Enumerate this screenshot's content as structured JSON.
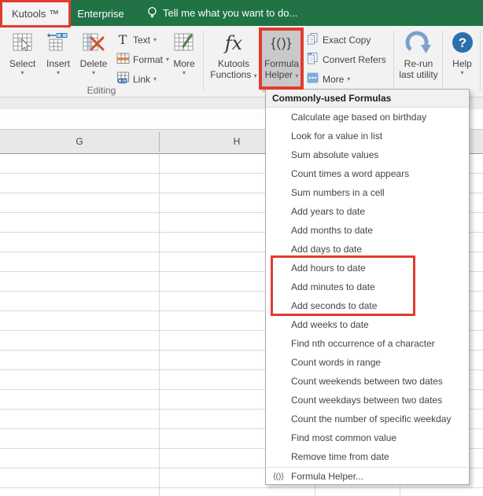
{
  "colors": {
    "excel_green": "#217346",
    "annotation_red": "#e23b2e",
    "help_blue": "#2c6fad",
    "pressed_gray": "#c9c9c9"
  },
  "tab_bar": {
    "tabs": [
      {
        "label": "Kutools ™"
      },
      {
        "label": "Enterprise"
      }
    ],
    "tell_me": "Tell me what you want to do..."
  },
  "ribbon": {
    "group_label": "Editing",
    "select_label": "Select",
    "insert_label": "Insert",
    "delete_label": "Delete",
    "text_label": "Text",
    "format_label": "Format",
    "link_label": "Link",
    "more_label": "More",
    "kutools_functions": {
      "icon": "fx",
      "line1": "Kutools",
      "line2": "Functions"
    },
    "formula_helper": {
      "icon": "{()}",
      "line1": "Formula",
      "line2": "Helper"
    },
    "exact_copy_label": "Exact Copy",
    "convert_refers_label": "Convert Refers",
    "more2_label": "More",
    "rerun": {
      "line1": "Re-run",
      "line2": "last utility"
    },
    "help_label": "Help"
  },
  "sheet": {
    "columns": [
      "G",
      "H"
    ]
  },
  "menu": {
    "header": "Commonly-used Formulas",
    "items": [
      "Calculate age based on birthday",
      "Look for a value in list",
      "Sum absolute values",
      "Count times a word appears",
      "Sum numbers in a cell",
      "Add years to date",
      "Add months to date",
      "Add days to date",
      "Add hours to date",
      "Add minutes to date",
      "Add seconds to date",
      "Add weeks to date",
      "Find nth occurrence of a character",
      "Count words in range",
      "Count weekends between two dates",
      "Count weekdays between two dates",
      "Count the number of specific weekday",
      "Find most common value",
      "Remove time from date"
    ],
    "highlighted_items": [
      "Add hours to date",
      "Add minutes to date",
      "Add seconds to date"
    ],
    "footer_icon": "{()}",
    "footer": "Formula Helper..."
  }
}
